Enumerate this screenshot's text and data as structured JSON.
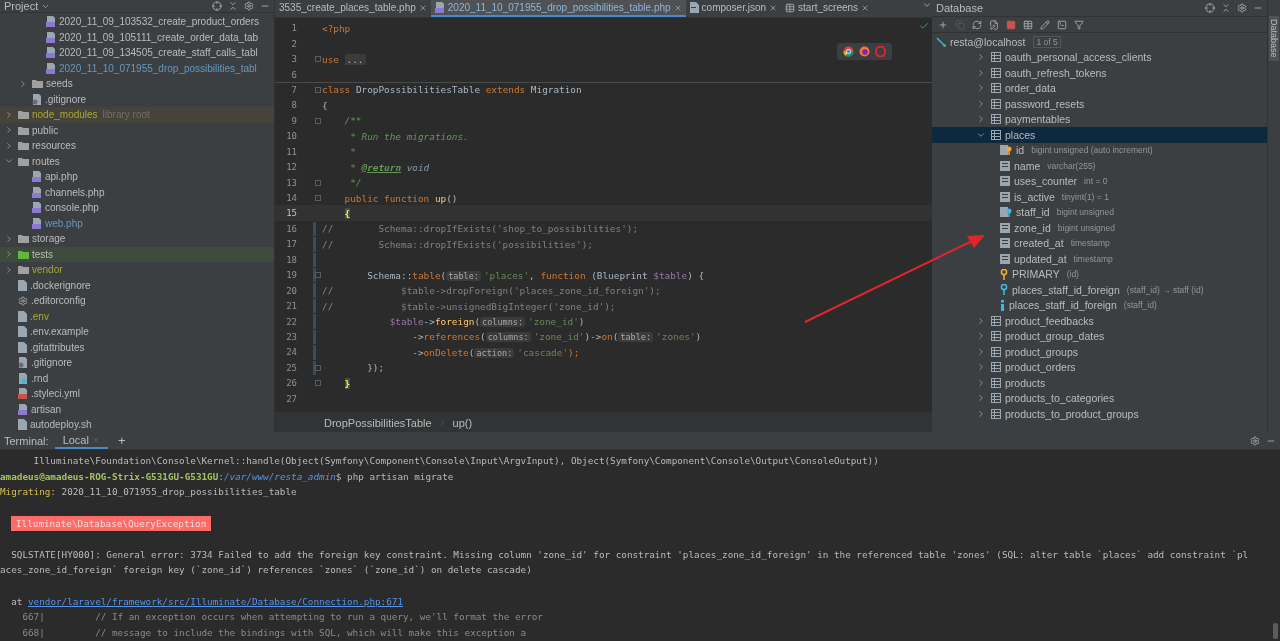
{
  "project": {
    "title": "Project",
    "tree": [
      {
        "children": [
          {
            "children": [
              {
                "label": "2020_11_09_103532_create_product_orders",
                "kind": "php"
              },
              {
                "label": "2020_11_09_105111_create_order_data_tab",
                "kind": "php"
              },
              {
                "label": "2020_11_09_134505_create_staff_calls_tabl",
                "kind": "php"
              },
              {
                "label": "2020_11_10_071955_drop_possibilities_tabl",
                "kind": "php",
                "color": "#6897bb"
              }
            ]
          },
          {
            "label": "seeds",
            "kind": "folder",
            "expanded": false
          },
          {
            "label": ".gitignore",
            "kind": "ignore"
          }
        ]
      },
      {
        "label": "node_modules",
        "kind": "library-folder",
        "expanded": false,
        "color": "#a8a832",
        "note": "library root"
      },
      {
        "label": "public",
        "kind": "folder",
        "expanded": false
      },
      {
        "label": "resources",
        "kind": "folder",
        "expanded": false
      },
      {
        "label": "routes",
        "kind": "folder",
        "expanded": true,
        "children": [
          {
            "label": "api.php",
            "kind": "php"
          },
          {
            "label": "channels.php",
            "kind": "php"
          },
          {
            "label": "console.php",
            "kind": "php"
          },
          {
            "label": "web.php",
            "kind": "php",
            "color": "#6897bb"
          }
        ]
      },
      {
        "label": "storage",
        "kind": "folder",
        "expanded": false
      },
      {
        "label": "tests",
        "kind": "test-folder",
        "expanded": false
      },
      {
        "label": "vendor",
        "kind": "folder",
        "expanded": false,
        "color": "#a8a832"
      },
      {
        "label": ".dockerignore",
        "kind": "file"
      },
      {
        "label": ".editorconfig",
        "kind": "gear"
      },
      {
        "label": ".env",
        "kind": "file",
        "color": "#a8a832"
      },
      {
        "label": ".env.example",
        "kind": "file"
      },
      {
        "label": ".gitattributes",
        "kind": "file"
      },
      {
        "label": ".gitignore",
        "kind": "ignore"
      },
      {
        "label": ".rnd",
        "kind": "rnd"
      },
      {
        "label": ".styleci.yml",
        "kind": "yml"
      },
      {
        "label": "artisan",
        "kind": "php"
      },
      {
        "label": "autodeploy.sh",
        "kind": "file"
      }
    ]
  },
  "editor": {
    "tabs": [
      {
        "label": "3535_create_places_table.php",
        "kind": "none",
        "selected": false
      },
      {
        "label": "2020_11_10_071955_drop_possibilities_table.php",
        "kind": "php",
        "selected": true
      },
      {
        "label": "composer.json",
        "kind": "json",
        "selected": false
      },
      {
        "label": "start_screens",
        "kind": "table",
        "selected": false
      }
    ],
    "lines": [
      {
        "n": "1",
        "tokens": [
          {
            "kind": "kw",
            "s": "<?php"
          }
        ]
      },
      {
        "n": "2"
      },
      {
        "n": "3",
        "fold": true,
        "tokens": [
          {
            "kind": "kw",
            "s": "use "
          },
          {
            "kind": "folded",
            "s": "..."
          }
        ]
      },
      {
        "n": "6"
      },
      {
        "n": "7",
        "fold": true,
        "separator_above": true,
        "tokens": [
          {
            "kind": "kw",
            "s": "class "
          },
          {
            "kind": "plain",
            "s": "DropPossibilitiesTable "
          },
          {
            "kind": "kw",
            "s": "extends "
          },
          {
            "kind": "plain",
            "s": "Migration"
          }
        ]
      },
      {
        "n": "8",
        "tokens": [
          {
            "kind": "plain",
            "s": "{"
          }
        ]
      },
      {
        "n": "9",
        "fold": true,
        "tokens": [
          {
            "kind": "doc",
            "s": "    /**"
          }
        ]
      },
      {
        "n": "10",
        "tokens": [
          {
            "kind": "doc",
            "s": "     * Run the migrations."
          }
        ]
      },
      {
        "n": "11",
        "tokens": [
          {
            "kind": "doc",
            "s": "     *"
          }
        ]
      },
      {
        "n": "12",
        "tokens": [
          {
            "kind": "doc",
            "s": "     * "
          },
          {
            "kind": "doctag",
            "s": "@return"
          },
          {
            "kind": "docword",
            "s": " void"
          }
        ]
      },
      {
        "n": "13",
        "fold": true,
        "tokens": [
          {
            "kind": "doc",
            "s": "     */"
          }
        ]
      },
      {
        "n": "14",
        "fold": true,
        "tokens": [
          {
            "kind": "kw",
            "s": "    public function "
          },
          {
            "kind": "fn",
            "s": "up"
          },
          {
            "kind": "plain",
            "s": "()"
          }
        ]
      },
      {
        "n": "15",
        "current": true,
        "tokens": [
          {
            "kind": "match",
            "s": "    {"
          }
        ]
      },
      {
        "n": "16",
        "changed": true,
        "tokens": [
          {
            "kind": "comment",
            "s": "//        Schema::dropIfExists('shop_to_possibilities');"
          }
        ]
      },
      {
        "n": "17",
        "changed": true,
        "tokens": [
          {
            "kind": "comment",
            "s": "//        Schema::dropIfExists('possibilities');"
          }
        ]
      },
      {
        "n": "18",
        "changed": true
      },
      {
        "n": "19",
        "changed": true,
        "fold": true,
        "tokens": [
          {
            "kind": "plain",
            "s": "        Schema::"
          },
          {
            "kind": "kw",
            "s": "table"
          },
          {
            "kind": "plain",
            "s": "("
          },
          {
            "kind": "hint",
            "s": "table:"
          },
          {
            "kind": "str",
            "s": "'places'"
          },
          {
            "kind": "plain",
            "s": ", "
          },
          {
            "kind": "kw",
            "s": "function "
          },
          {
            "kind": "plain",
            "s": "(Blueprint "
          },
          {
            "kind": "var",
            "s": "$table"
          },
          {
            "kind": "plain",
            "s": ") {"
          }
        ]
      },
      {
        "n": "20",
        "changed": true,
        "tokens": [
          {
            "kind": "comment",
            "s": "//            $table->dropForeign('places_zone_id_foreign');"
          }
        ]
      },
      {
        "n": "21",
        "changed": true,
        "tokens": [
          {
            "kind": "comment",
            "s": "//            $table->unsignedBigInteger('zone_id');"
          }
        ]
      },
      {
        "n": "22",
        "changed": true,
        "tokens": [
          {
            "kind": "var",
            "s": "            $table"
          },
          {
            "kind": "plain",
            "s": "->"
          },
          {
            "kind": "fn",
            "s": "foreign"
          },
          {
            "kind": "plain",
            "s": "("
          },
          {
            "kind": "hint",
            "s": "columns:"
          },
          {
            "kind": "str",
            "s": "'zone_id'"
          },
          {
            "kind": "plain",
            "s": ")"
          }
        ]
      },
      {
        "n": "23",
        "changed": true,
        "tokens": [
          {
            "kind": "plain",
            "s": "                ->"
          },
          {
            "kind": "kw",
            "s": "references"
          },
          {
            "kind": "plain",
            "s": "("
          },
          {
            "kind": "hint",
            "s": "columns:"
          },
          {
            "kind": "str",
            "s": "'zone_id'"
          },
          {
            "kind": "plain",
            "s": ")->"
          },
          {
            "kind": "kw",
            "s": "on"
          },
          {
            "kind": "plain",
            "s": "("
          },
          {
            "kind": "hint",
            "s": "table:"
          },
          {
            "kind": "str",
            "s": "'zones'"
          },
          {
            "kind": "plain",
            "s": ")"
          }
        ]
      },
      {
        "n": "24",
        "changed": true,
        "tokens": [
          {
            "kind": "plain",
            "s": "                ->"
          },
          {
            "kind": "kw",
            "s": "onDelete"
          },
          {
            "kind": "plain",
            "s": "("
          },
          {
            "kind": "hint",
            "s": "action:"
          },
          {
            "kind": "str",
            "s": "'cascade'"
          },
          {
            "kind": "kw",
            "s": ");"
          }
        ]
      },
      {
        "n": "25",
        "changed": true,
        "fold": true,
        "tokens": [
          {
            "kind": "plain",
            "s": "        });"
          }
        ]
      },
      {
        "n": "26",
        "fold": true,
        "tokens": [
          {
            "kind": "match",
            "s": "    }"
          }
        ]
      },
      {
        "n": "27"
      }
    ],
    "breadcrumb": [
      "DropPossibilitiesTable",
      "up()"
    ]
  },
  "database": {
    "title": "Database",
    "connection": {
      "label": "resta@localhost",
      "badge": "1 of 5"
    },
    "tables": [
      {
        "label": "oauth_personal_access_clients",
        "expanded": false,
        "selected": false
      },
      {
        "label": "oauth_refresh_tokens",
        "expanded": false,
        "selected": false
      },
      {
        "label": "order_data",
        "expanded": false,
        "selected": false
      },
      {
        "label": "password_resets",
        "expanded": false,
        "selected": false
      },
      {
        "label": "paymentables",
        "expanded": false,
        "selected": false
      },
      {
        "label": "places",
        "expanded": true,
        "selected": true,
        "children": [
          {
            "label": "id",
            "type": "bigint unsigned (auto increment)",
            "kind": "pk"
          },
          {
            "label": "name",
            "type": "varchar(255)",
            "kind": "column"
          },
          {
            "label": "uses_counter",
            "type": "int = 0",
            "kind": "column"
          },
          {
            "label": "is_active",
            "type": "tinyint(1) = 1",
            "kind": "column"
          },
          {
            "label": "staff_id",
            "type": "bigint unsigned",
            "kind": "fk"
          },
          {
            "label": "zone_id",
            "type": "bigint unsigned",
            "kind": "column"
          },
          {
            "label": "created_at",
            "type": "timestamp",
            "kind": "column"
          },
          {
            "label": "updated_at",
            "type": "timestamp",
            "kind": "column"
          },
          {
            "label": "PRIMARY",
            "type": "(id)",
            "kind": "key"
          },
          {
            "label": "places_staff_id_foreign",
            "type": "(staff_id) → staff (id)",
            "kind": "foreign-key"
          },
          {
            "label": "places_staff_id_foreign",
            "type": "(staff_id)",
            "kind": "index"
          }
        ]
      },
      {
        "label": "product_feedbacks",
        "expanded": false,
        "selected": false
      },
      {
        "label": "product_group_dates",
        "expanded": false,
        "selected": false
      },
      {
        "label": "product_groups",
        "expanded": false,
        "selected": false
      },
      {
        "label": "product_orders",
        "expanded": false,
        "selected": false
      },
      {
        "label": "products",
        "expanded": false,
        "selected": false
      },
      {
        "label": "products_to_categories",
        "expanded": false,
        "selected": false
      },
      {
        "label": "products_to_product_groups",
        "expanded": false,
        "selected": false
      }
    ]
  },
  "side_strip": {
    "label": "Database"
  },
  "terminal": {
    "title": "Terminal:",
    "tabs": [
      {
        "label": "Local",
        "selected": true
      }
    ],
    "add": "+",
    "lines": [
      {
        "kind": "text",
        "tokens": [
          {
            "kind": "plain",
            "s": "      Illuminate\\Foundation\\Console\\Kernel::handle(Object(Symfony\\Component\\Console\\Input\\ArgvInput), Object(Symfony\\Component\\Console\\Output\\ConsoleOutput))"
          }
        ]
      },
      {
        "kind": "text",
        "tokens": [
          {
            "kind": "user",
            "s": "amadeus@amadeus-ROG-Strix-G531GU-G531GU"
          },
          {
            "kind": "plain",
            "s": ":"
          },
          {
            "kind": "path",
            "s": "/var/www/resta_admin"
          },
          {
            "kind": "plain",
            "s": "$ php artisan migrate"
          }
        ]
      },
      {
        "kind": "text",
        "tokens": [
          {
            "kind": "label",
            "s": "Migrating:"
          },
          {
            "kind": "plain",
            "s": " 2020_11_10_071955_drop_possibilities_table"
          }
        ]
      },
      {
        "kind": "blank"
      },
      {
        "kind": "text",
        "tokens": [
          {
            "kind": "error",
            "s": "Illuminate\\Database\\QueryException"
          }
        ]
      },
      {
        "kind": "blank"
      },
      {
        "kind": "text",
        "tokens": [
          {
            "kind": "plain",
            "s": "  SQLSTATE[HY000]: General error: 3734 Failed to add the foreign key constraint. Missing column 'zone_id' for constraint 'places_zone_id_foreign' in the referenced table 'zones' (SQL: alter table `places` add constraint `pl"
          }
        ]
      },
      {
        "kind": "text",
        "tokens": [
          {
            "kind": "plain",
            "s": "aces_zone_id_foreign` foreign key (`zone_id`) references `zones` (`zone_id`) on delete cascade)"
          }
        ]
      },
      {
        "kind": "blank"
      },
      {
        "kind": "text",
        "tokens": [
          {
            "kind": "plain",
            "s": "  at "
          },
          {
            "kind": "link",
            "s": "vendor/laravel/framework/src/Illuminate/Database/Connection.php:671"
          }
        ]
      },
      {
        "kind": "text",
        "tokens": [
          {
            "kind": "dim",
            "s": "    667|         // If an exception occurs when attempting to run a query, we'll format the error"
          }
        ]
      },
      {
        "kind": "text",
        "tokens": [
          {
            "kind": "dim",
            "s": "    668|         // message to include the bindings with SQL, which will make this exception a"
          }
        ]
      }
    ]
  }
}
